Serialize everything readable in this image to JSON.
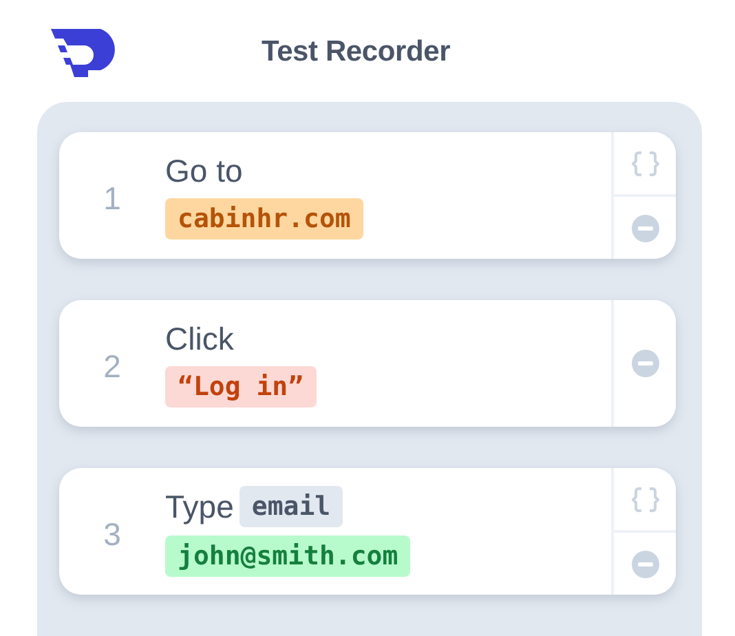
{
  "header": {
    "title": "Test Recorder"
  },
  "steps": [
    {
      "number": "1",
      "action": "Go to",
      "value": {
        "kind": "url",
        "text": "cabinhr.com"
      },
      "variable_button": true
    },
    {
      "number": "2",
      "action": "Click",
      "value": {
        "kind": "text",
        "text": "“Log in”"
      },
      "variable_button": false
    },
    {
      "number": "3",
      "action": "Type",
      "field": "email",
      "value": {
        "kind": "input",
        "text": "john@smith.com"
      },
      "variable_button": true
    }
  ]
}
